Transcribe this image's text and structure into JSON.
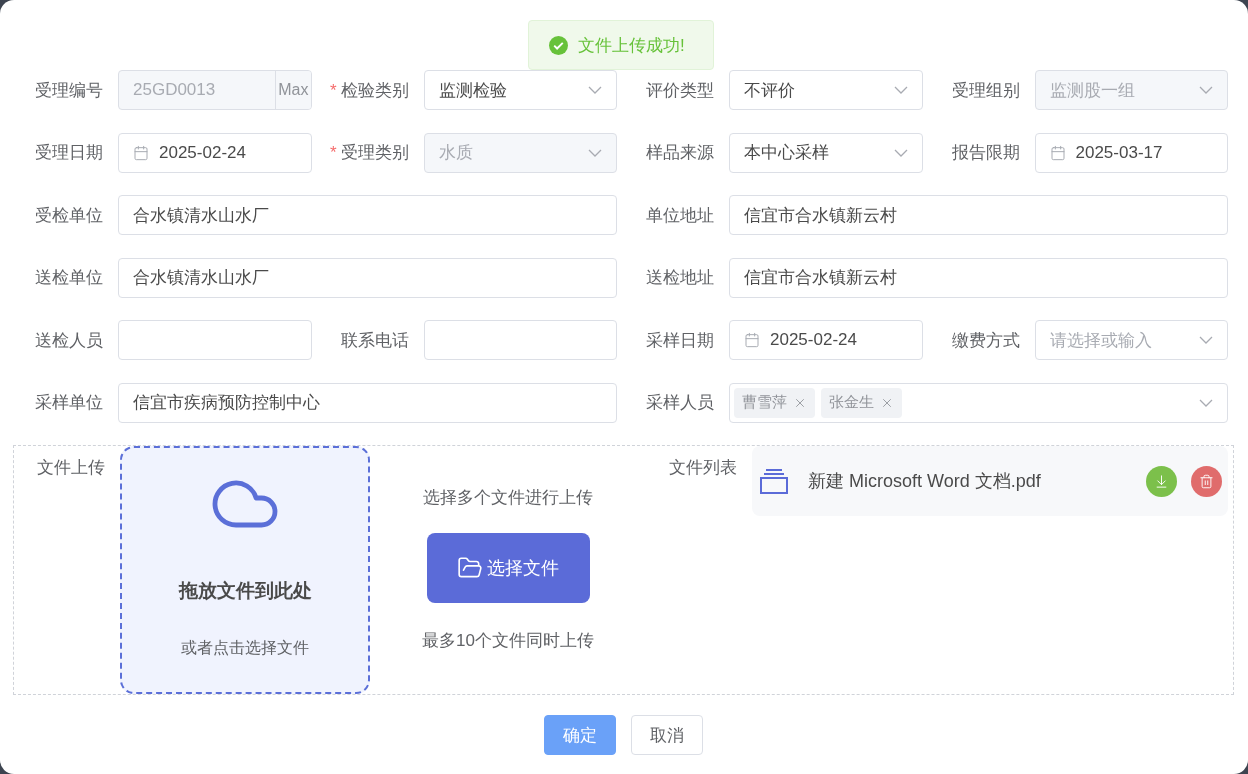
{
  "required_mark": "*",
  "toast": {
    "kind": "success",
    "message": "文件上传成功!"
  },
  "rows": [
    [
      {
        "label": "受理编号",
        "required": false,
        "kind": "input",
        "value": "25GD0013",
        "append": "Max",
        "disabled": true
      },
      {
        "label": "检验类别",
        "required": true,
        "kind": "select",
        "value": "监测检验"
      },
      {
        "label": "评价类型",
        "required": false,
        "kind": "select",
        "value": "不评价"
      },
      {
        "label": "受理组别",
        "required": false,
        "kind": "select",
        "value": "监测股一组",
        "disabled": true
      }
    ],
    [
      {
        "label": "受理日期",
        "required": false,
        "kind": "date",
        "value": "2025-02-24"
      },
      {
        "label": "受理类别",
        "required": true,
        "kind": "select",
        "value": "水质",
        "disabled": true
      },
      {
        "label": "样品来源",
        "required": false,
        "kind": "select",
        "value": "本中心采样"
      },
      {
        "label": "报告限期",
        "required": false,
        "kind": "date",
        "value": "2025-03-17"
      }
    ],
    [
      {
        "label": "受检单位",
        "required": false,
        "kind": "input",
        "value": "合水镇清水山水厂"
      },
      {
        "label": "单位地址",
        "required": false,
        "kind": "input",
        "value": "信宜市合水镇新云村"
      }
    ],
    [
      {
        "label": "送检单位",
        "required": false,
        "kind": "input",
        "value": "合水镇清水山水厂"
      },
      {
        "label": "送检地址",
        "required": false,
        "kind": "input",
        "value": "信宜市合水镇新云村"
      }
    ],
    [
      {
        "label": "送检人员",
        "required": false,
        "kind": "input"
      },
      {
        "label": "联系电话",
        "required": false,
        "kind": "input"
      },
      {
        "label": "采样日期",
        "required": false,
        "kind": "date",
        "value": "2025-02-24"
      },
      {
        "label": "缴费方式",
        "required": false,
        "kind": "select",
        "placeholder": "请选择或输入"
      }
    ],
    [
      {
        "label": "采样单位",
        "required": false,
        "kind": "input",
        "value": "信宜市疾病预防控制中心"
      },
      {
        "label": "采样人员",
        "required": false,
        "kind": "tags",
        "tags": [
          "曹雪萍",
          "张金生"
        ]
      }
    ]
  ],
  "upload": {
    "label": "文件上传",
    "drop_title": "拖放文件到此处",
    "drop_hint": "或者点击选择文件",
    "multi_hint": "选择多个文件进行上传",
    "button": "选择文件",
    "limit_hint": "最多10个文件同时上传"
  },
  "file_list": {
    "label": "文件列表",
    "files": [
      {
        "name": "新建 Microsoft Word 文档.pdf"
      }
    ]
  },
  "footer": [
    {
      "label": "确定",
      "kind": "primary"
    },
    {
      "label": "取消",
      "kind": "default"
    }
  ]
}
